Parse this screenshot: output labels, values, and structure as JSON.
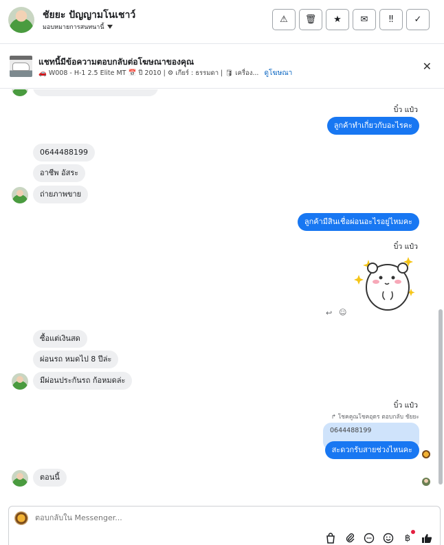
{
  "header": {
    "contact_name": "ชัยยะ ปัญญามโนเชาว์",
    "assign_label": "มอบหมายการสนทนานี้",
    "actions": [
      {
        "icon": "alert-triangle-icon",
        "glyph": "⚠"
      },
      {
        "icon": "trash-icon",
        "glyph": "🗑"
      },
      {
        "icon": "star-icon",
        "glyph": "★"
      },
      {
        "icon": "envelope-open-icon",
        "glyph": "✉"
      },
      {
        "icon": "double-exclamation-icon",
        "glyph": "‼"
      },
      {
        "icon": "check-icon",
        "glyph": "✓"
      }
    ]
  },
  "ad": {
    "title": "แชทนี้มีข้อความตอบกลับต่อโฆษณาของคุณ",
    "details": "🚗 W008 - H-1 2.5 Elite MT 📅 ปี 2010 | ⚙ เกียร์ : ธรรมดา | 🛢 เครื่อง...",
    "link": "ดูโฆษณา",
    "close_icon": "close-icon"
  },
  "messages": {
    "sender_1": "บิ๋ว แป๋ว",
    "out_1": "ลูกค้าทำเกี่ยวกับอะไรคะ",
    "in_phone": "0644488199",
    "in_job": "อาชีพ อัสระ",
    "in_photo": "ถ่ายภาพขาย",
    "out_2": "ลูกค้ามีสินเชื่อผ่อนอะไรอยู่ไหมคะ",
    "sender_2": "บิ๋ว แป๋ว",
    "in_cash": "ซื้อแต่เงินสด",
    "in_car": "ผ่อนรถ หมดไป  8 ปีล่ะ",
    "in_insurance": "มีผ่อนประกันรถ  ก้อหมดล่ะ",
    "sender_3": "บิ๋ว แป๋ว",
    "reply_note": "โชคคูณโชคอุดร ตอบกลับ ชัยยะ",
    "quoted": "0644488199",
    "out_3": "สะดวกรับสายช่วงไหนคะ",
    "in_now": "ตอนนี้"
  },
  "composer": {
    "placeholder": "ตอบกลับใน Messenger...",
    "tools": [
      {
        "icon": "shopping-bag-icon",
        "glyph": "👜"
      },
      {
        "icon": "paperclip-icon",
        "glyph": "📎"
      },
      {
        "icon": "chat-bubble-icon",
        "glyph": "💬"
      },
      {
        "icon": "smiley-icon",
        "glyph": "☺"
      },
      {
        "icon": "baht-icon",
        "glyph": "฿"
      },
      {
        "icon": "thumbs-up-icon",
        "glyph": "👍"
      }
    ]
  },
  "colors": {
    "outgoing_bubble": "#1877f2",
    "incoming_bubble": "#eeeff1",
    "quoted_bubble": "#cfe3fb",
    "link": "#0a66c2"
  }
}
